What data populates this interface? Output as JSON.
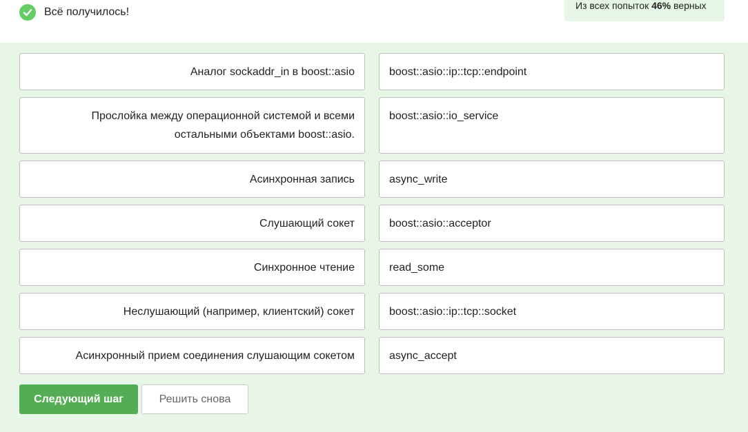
{
  "status": {
    "icon": "checkmark-circle-icon",
    "message": "Всё получилось!"
  },
  "stats": {
    "prefix": "Из всех попыток",
    "percent": "46%",
    "suffix": "верных"
  },
  "pairs": [
    {
      "term": "Аналог sockaddr_in в boost::asio",
      "definition": "boost::asio::ip::tcp::endpoint"
    },
    {
      "term": "Прослойка между операционной системой и всеми остальными объектами boost::asio.",
      "definition": "boost::asio::io_service"
    },
    {
      "term": "Асинхронная запись",
      "definition": "async_write"
    },
    {
      "term": "Слушающий сокет",
      "definition": "boost::asio::acceptor"
    },
    {
      "term": "Синхронное чтение",
      "definition": "read_some"
    },
    {
      "term": "Неслушающий (например, клиентский) сокет",
      "definition": "boost::asio::ip::tcp::socket"
    },
    {
      "term": "Асинхронный прием соединения слушающим сокетом",
      "definition": "async_accept"
    }
  ],
  "buttons": {
    "next_label": "Следующий шаг",
    "retry_label": "Решить снова"
  },
  "colors": {
    "accent": "#54ad54",
    "success_icon": "#66cc66",
    "panel_bg": "#e8f6e8"
  }
}
